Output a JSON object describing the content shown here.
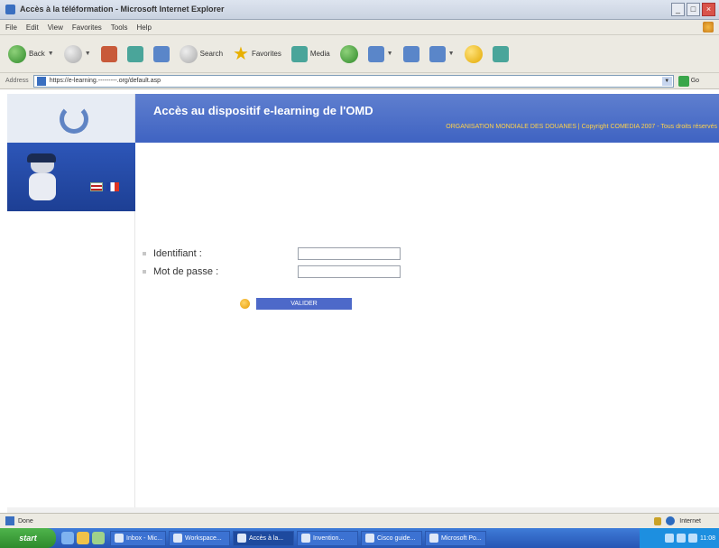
{
  "window": {
    "title": "Accès à la téléformation - Microsoft Internet Explorer",
    "controls": [
      "_",
      "□",
      "×"
    ]
  },
  "menu": [
    "File",
    "Edit",
    "View",
    "Favorites",
    "Tools",
    "Help"
  ],
  "toolbar": {
    "back": "Back",
    "search": "Search",
    "favorites": "Favorites",
    "media": "Media"
  },
  "address": {
    "label": "Address",
    "url": "https://e-learning.---------.org/default.asp",
    "go": "Go"
  },
  "site": {
    "banner_title": "Accès au dispositif e-learning de l'OMD",
    "banner_subtitle": "ORGANISATION MONDIALE DES DOUANES | Copyright COMEDIA 2007 - Tous droits réservés"
  },
  "login": {
    "username_label": "Identifiant   :",
    "password_label": "Mot de passe   :",
    "username_value": "",
    "password_value": "",
    "submit_label": "VALIDER"
  },
  "status": {
    "text": "Done",
    "zone": "Internet"
  },
  "taskbar": {
    "start": "start",
    "tasks": [
      "Inbox - Mic...",
      "Workspace...",
      "Accès à la...",
      "Invention...",
      "Cisco guide...",
      "Microsoft Po..."
    ],
    "clock": "11:08"
  }
}
